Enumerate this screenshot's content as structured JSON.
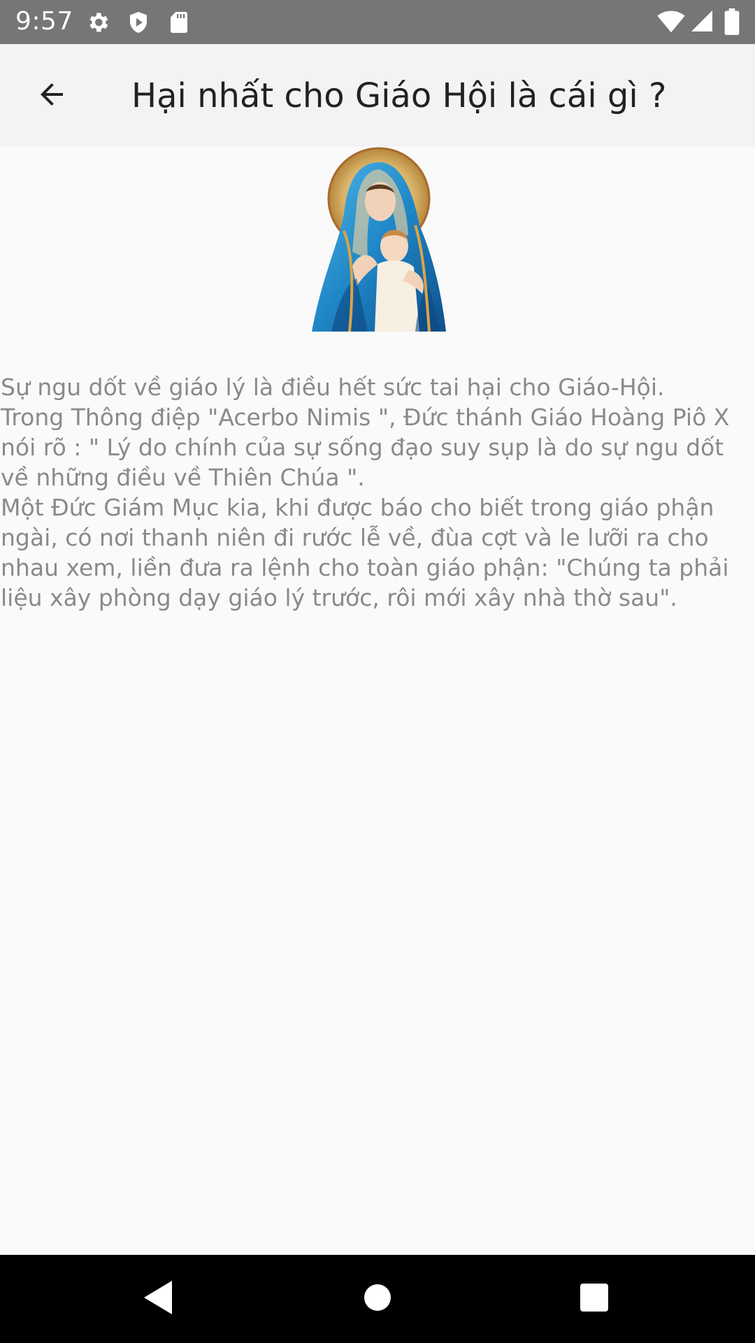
{
  "status_bar": {
    "time": "9:57",
    "left_icons": [
      "gear-icon",
      "shield-icon",
      "sd-card-icon"
    ],
    "right_icons": [
      "wifi-icon",
      "signal-icon",
      "battery-icon"
    ]
  },
  "app_bar": {
    "back_icon": "arrow-left-icon",
    "title": "Hại nhất cho Giáo Hội là cái gì ?"
  },
  "content": {
    "image": "madonna-and-child-image",
    "paragraphs": "Sự ngu dốt về giáo lý là điều hết sức tai hại cho Giáo-Hội.\nTrong Thông điệp \"Acerbo Nimis \", Đức thánh Giáo Hoàng Piô X nói rõ : \" Lý do chính của sự sống đạo suy sụp là do sự ngu dốt về những điều về Thiên Chúa \".\nMột Đức Giám Mục kia, khi được báo cho biết trong giáo phận ngài, có nơi thanh niên đi rước lễ về, đùa cợt và le lưỡi ra cho nhau xem, liền đưa ra lệnh cho toàn giáo phận: \"Chúng ta phải liệu xây phòng dạy giáo lý trước, rôi mới xây nhà thờ sau\"."
  },
  "nav_bar": {
    "back": "triangle-back-icon",
    "home": "circle-home-icon",
    "recents": "square-recents-icon"
  },
  "colors": {
    "status_bar": "#767676",
    "app_bar": "#f3f3f3",
    "background": "#fafafa",
    "body_text": "#8a8a8a",
    "title_text": "#222222"
  }
}
